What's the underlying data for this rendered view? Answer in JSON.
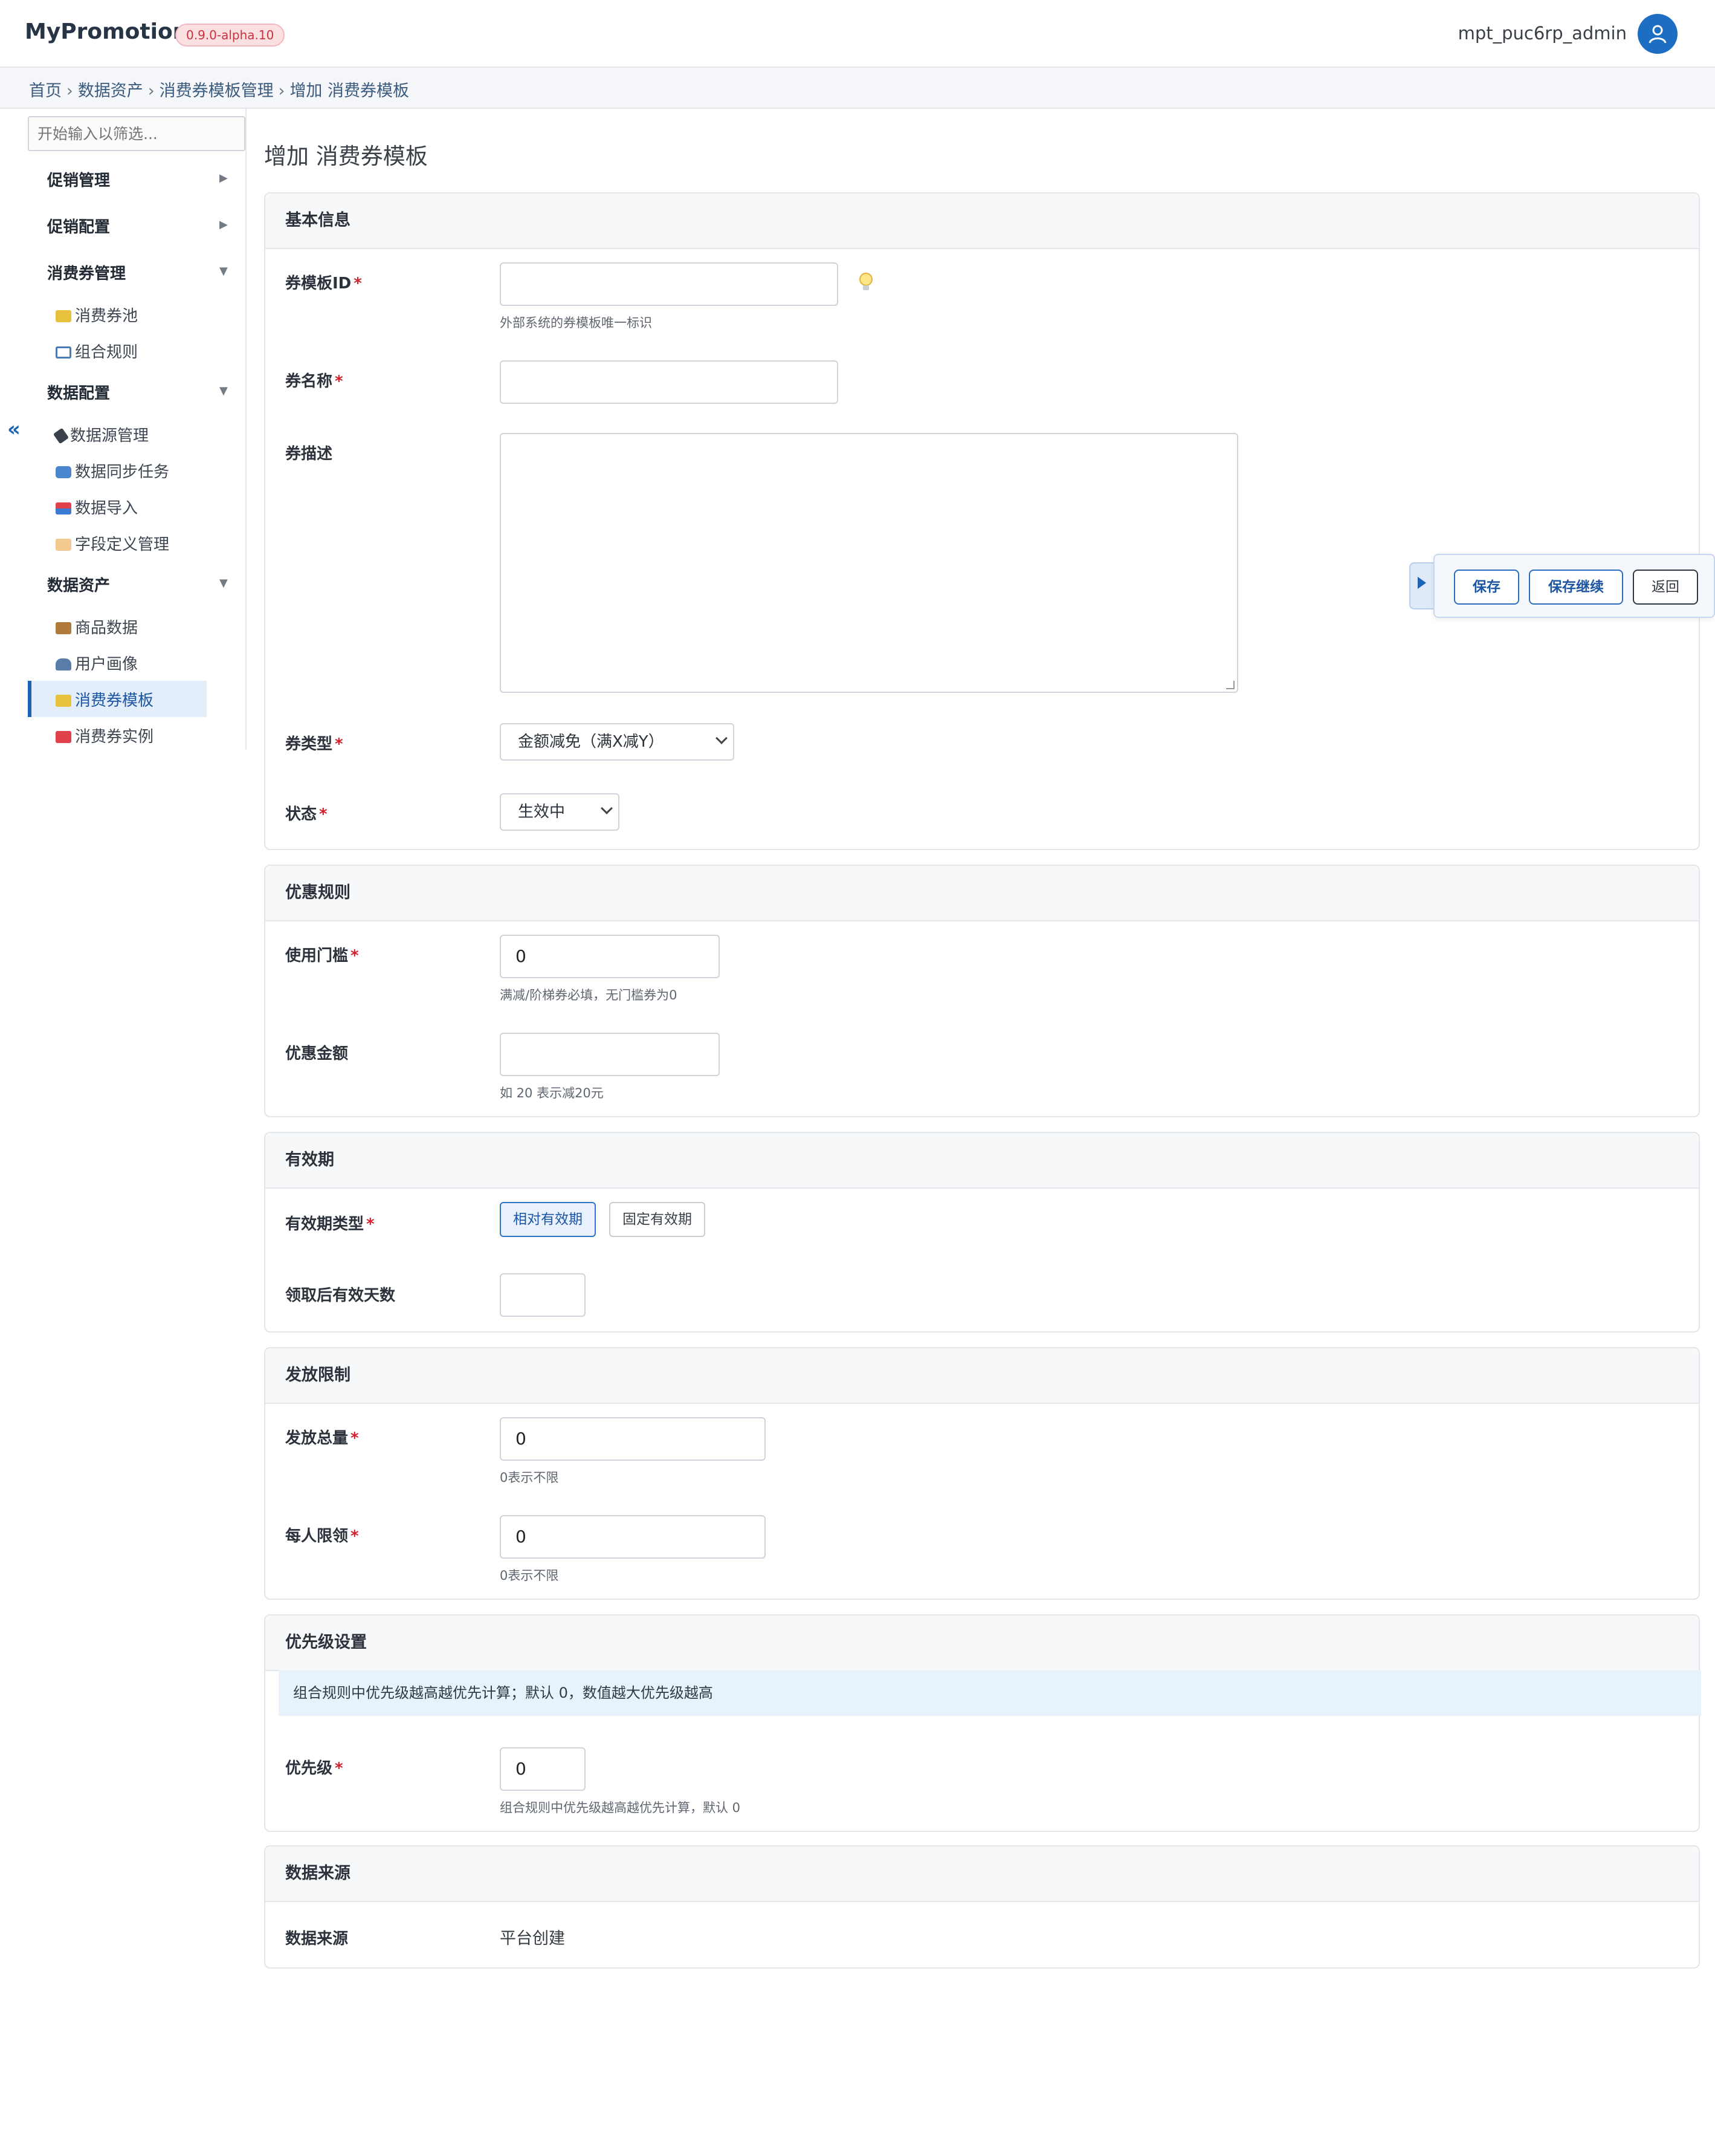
{
  "header": {
    "brand": "MyPromotion",
    "version": "0.9.0-alpha.10",
    "username": "mpt_puc6rp_admin"
  },
  "breadcrumb": {
    "items": [
      "首页",
      "数据资产",
      "消费券模板管理",
      "增加 消费券模板"
    ]
  },
  "sidebar": {
    "filter_placeholder": "开始输入以筛选...",
    "groups": [
      {
        "label": "促销管理",
        "arrow": "▶"
      },
      {
        "label": "促销配置",
        "arrow": "▶"
      },
      {
        "label": "消费券管理",
        "arrow": "▼"
      },
      {
        "label": "数据配置",
        "arrow": "▼"
      },
      {
        "label": "数据资产",
        "arrow": "▼"
      }
    ],
    "items": [
      {
        "label": "消费券池",
        "icon": "ticket-icon"
      },
      {
        "label": "组合规则",
        "icon": "rules-icon"
      },
      {
        "label": "数据源管理",
        "icon": "plug-icon"
      },
      {
        "label": "数据同步任务",
        "icon": "sync-icon"
      },
      {
        "label": "数据导入",
        "icon": "import-icon"
      },
      {
        "label": "字段定义管理",
        "icon": "tag-icon"
      },
      {
        "label": "商品数据",
        "icon": "package-icon"
      },
      {
        "label": "用户画像",
        "icon": "user-icon"
      },
      {
        "label": "消费券模板",
        "icon": "ticket-icon"
      },
      {
        "label": "消费券实例",
        "icon": "ticket-red-icon"
      }
    ],
    "collapse_glyph": "«"
  },
  "page": {
    "title": "增加 消费券模板"
  },
  "basic": {
    "heading": "基本信息",
    "template_id_label": "券模板ID",
    "template_id_value": "",
    "template_id_help": "外部系统的券模板唯一标识",
    "name_label": "券名称",
    "name_value": "",
    "desc_label": "券描述",
    "desc_value": "",
    "type_label": "券类型",
    "type_value": "金额减免（满X减Y）",
    "status_label": "状态",
    "status_value": "生效中"
  },
  "discount": {
    "heading": "优惠规则",
    "threshold_label": "使用门槛",
    "threshold_value": "0",
    "threshold_help": "满减/阶梯券必填，无门槛券为0",
    "amount_label": "优惠金额",
    "amount_value": "",
    "amount_help": "如 20 表示减20元"
  },
  "validity": {
    "heading": "有效期",
    "type_label": "有效期类型",
    "option_relative": "相对有效期",
    "option_fixed": "固定有效期",
    "days_label": "领取后有效天数",
    "days_value": ""
  },
  "issue": {
    "heading": "发放限制",
    "total_label": "发放总量",
    "total_value": "0",
    "total_help": "0表示不限",
    "per_user_label": "每人限领",
    "per_user_value": "0",
    "per_user_help": "0表示不限"
  },
  "priority": {
    "heading": "优先级设置",
    "notice": "组合规则中优先级越高越优先计算；默认 0，数值越大优先级越高",
    "label": "优先级",
    "value": "0",
    "help": "组合规则中优先级越高越优先计算，默认 0"
  },
  "source": {
    "heading": "数据来源",
    "label": "数据来源",
    "value": "平台创建"
  },
  "actions": {
    "save": "保存",
    "save_continue": "保存继续",
    "back": "返回"
  },
  "colors": {
    "accent": "#1b64b5",
    "required": "#d0212e",
    "badge_bg": "#fbe0e2"
  }
}
